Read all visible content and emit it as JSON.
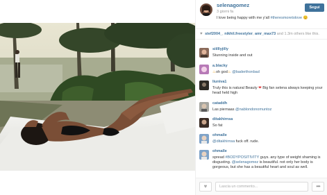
{
  "post": {
    "owner": "selenagomez",
    "time": "3 giorni fa",
    "caption_text": "I love being happy with me y'all ",
    "caption_hashtag": "#theresmoretolove",
    "caption_emoji": "😊",
    "follow_label": "Segui"
  },
  "likes": {
    "names": [
      "stef2004_",
      "nikhil.freestyler",
      "amr_max73"
    ],
    "suffix": "and 1.3m others like this."
  },
  "comments": [
    {
      "user": "siilllyjilly",
      "text": "Stunning inside and out"
    },
    {
      "user": "a.blacky",
      "text_before": "oh god",
      "mention": "@baderthonbad"
    },
    {
      "user": "liuniva1",
      "text_before": "Truly this is natural Beauty ",
      "text_after": " Big fan selena always keeping your head held high"
    },
    {
      "user": "cataddh",
      "text_before": "Las piernaas ",
      "mention": "@nablondonomuntoz"
    },
    {
      "user": "ditakhirnsa",
      "text": "So fat"
    },
    {
      "user": "ohmalle",
      "mention": "@ditakhirnsa",
      "text_after": " fuck off. rude."
    },
    {
      "user": "ohmalle",
      "text_before": "spread ",
      "hashtag": "#BODYPOSITIVITY",
      "text_mid": " guys. any type of weight shaming is disgusting. ",
      "mention": "@selenagomez",
      "text_after": " is beautiful. not only her body is gorgeous, but she has a beautiful heart and soul as well."
    }
  ],
  "footer": {
    "comment_placeholder": "Lascia un commento...",
    "more_label": "•••"
  },
  "icons": {
    "like": "heart-icon",
    "more": "more-options-icon"
  },
  "colors": {
    "link": "#3f729b",
    "follow_button": "#3f729b",
    "muted": "#999999"
  }
}
